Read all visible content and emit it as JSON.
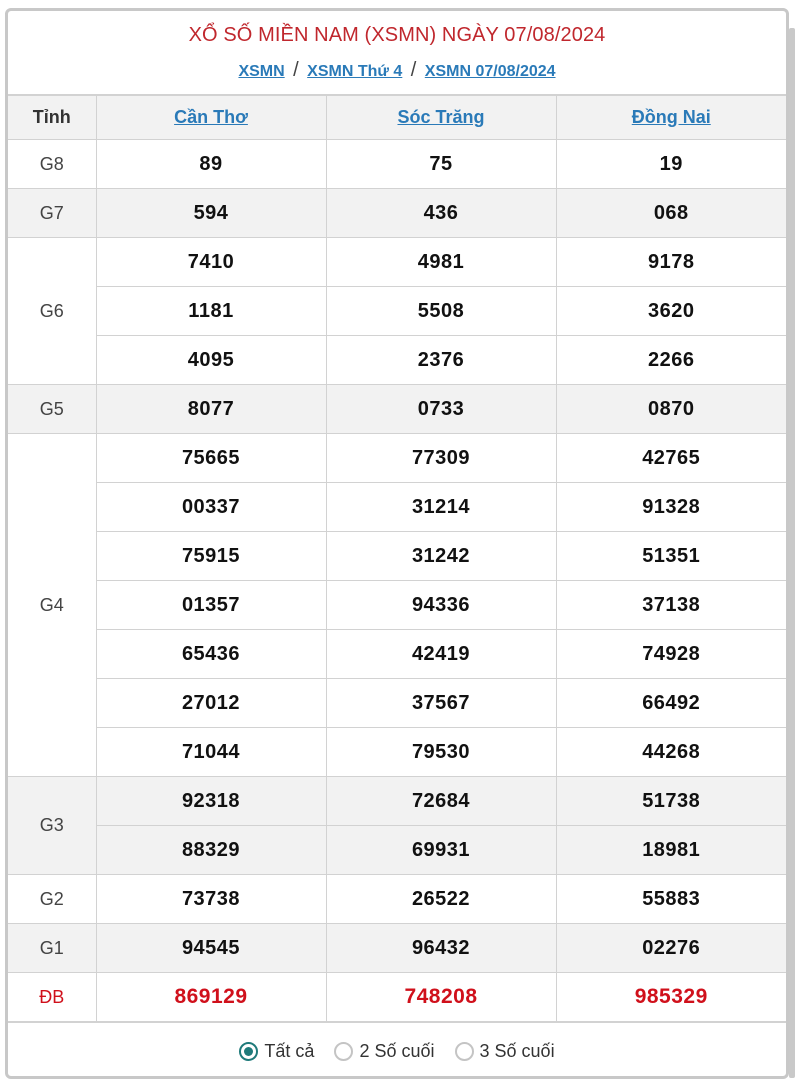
{
  "header": {
    "title": "XỔ SỐ MIỀN NAM (XSMN) NGÀY 07/08/2024",
    "breadcrumbs": [
      {
        "label": "XSMN"
      },
      {
        "label": "XSMN Thứ 4"
      },
      {
        "label": "XSMN 07/08/2024"
      }
    ],
    "separator": "/"
  },
  "table": {
    "first_col_header": "Tỉnh",
    "provinces": [
      "Cần Thơ",
      "Sóc Trăng",
      "Đồng Nai"
    ],
    "prizes": [
      {
        "label": "G8",
        "rows": [
          [
            "89",
            "75",
            "19"
          ]
        ]
      },
      {
        "label": "G7",
        "rows": [
          [
            "594",
            "436",
            "068"
          ]
        ]
      },
      {
        "label": "G6",
        "rows": [
          [
            "7410",
            "4981",
            "9178"
          ],
          [
            "1181",
            "5508",
            "3620"
          ],
          [
            "4095",
            "2376",
            "2266"
          ]
        ]
      },
      {
        "label": "G5",
        "rows": [
          [
            "8077",
            "0733",
            "0870"
          ]
        ]
      },
      {
        "label": "G4",
        "rows": [
          [
            "75665",
            "77309",
            "42765"
          ],
          [
            "00337",
            "31214",
            "91328"
          ],
          [
            "75915",
            "31242",
            "51351"
          ],
          [
            "01357",
            "94336",
            "37138"
          ],
          [
            "65436",
            "42419",
            "74928"
          ],
          [
            "27012",
            "37567",
            "66492"
          ],
          [
            "71044",
            "79530",
            "44268"
          ]
        ]
      },
      {
        "label": "G3",
        "rows": [
          [
            "92318",
            "72684",
            "51738"
          ],
          [
            "88329",
            "69931",
            "18981"
          ]
        ]
      },
      {
        "label": "G2",
        "rows": [
          [
            "73738",
            "26522",
            "55883"
          ]
        ]
      },
      {
        "label": "G1",
        "rows": [
          [
            "94545",
            "96432",
            "02276"
          ]
        ]
      },
      {
        "label": "ĐB",
        "rows": [
          [
            "869129",
            "748208",
            "985329"
          ]
        ],
        "special": true
      }
    ]
  },
  "filter": {
    "options": [
      {
        "label": "Tất cả",
        "checked": true
      },
      {
        "label": "2 Số cuối",
        "checked": false
      },
      {
        "label": "3 Số cuối",
        "checked": false
      }
    ]
  },
  "colors": {
    "title": "#c0272d",
    "link": "#2a7ab8",
    "special_prize": "#d0101b",
    "radio_checked": "#1f7a7a",
    "row_shade": "#f2f2f2"
  }
}
